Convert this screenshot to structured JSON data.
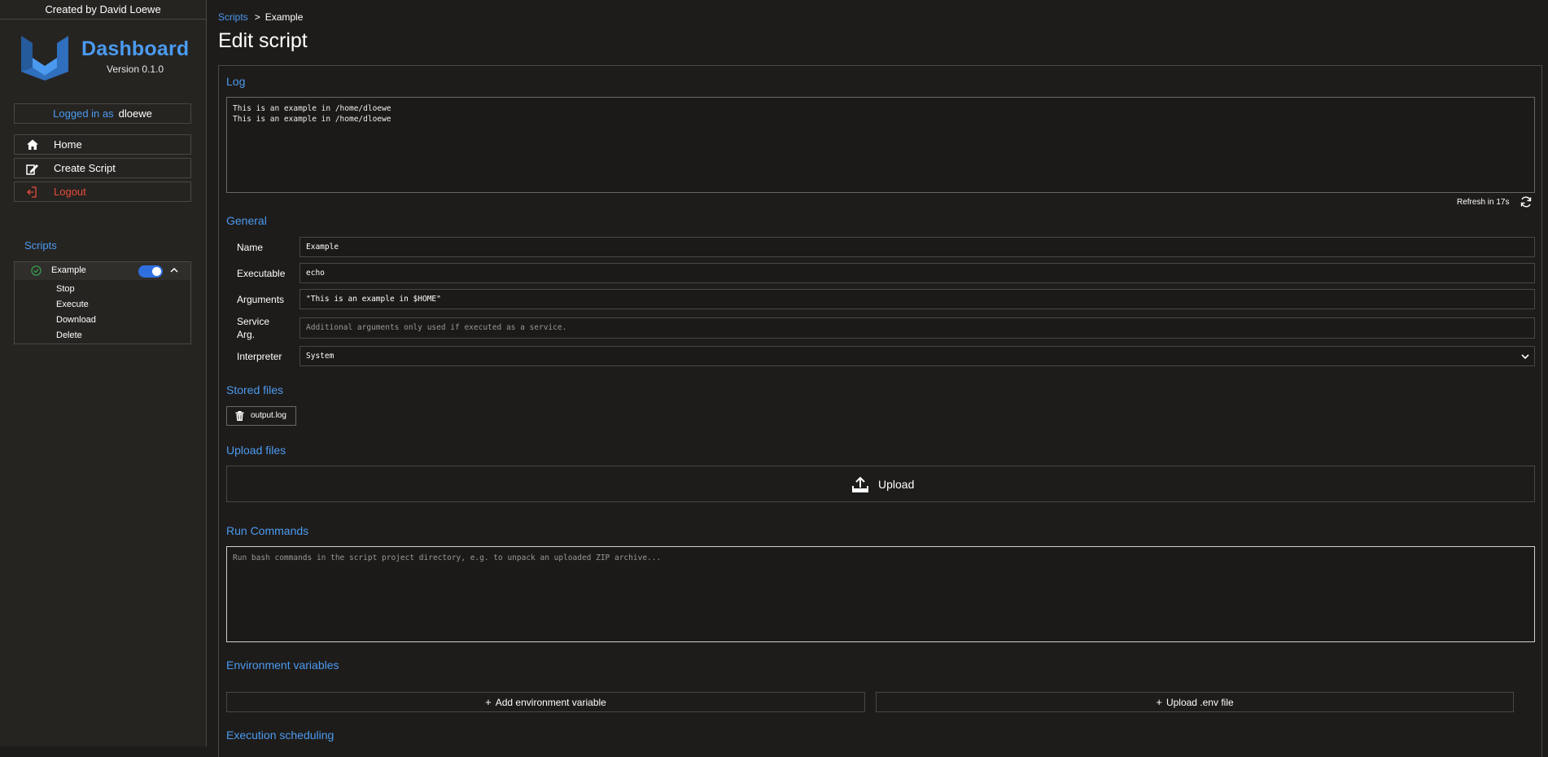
{
  "sidebar": {
    "credit": "Created by David Loewe",
    "brand_title": "Dashboard",
    "brand_version": "Version 0.1.0",
    "login_label": "Logged in as",
    "username": "dloewe",
    "nav": {
      "home": "Home",
      "create_script": "Create Script",
      "logout": "Logout"
    },
    "scripts_heading": "Scripts",
    "script": {
      "name": "Example",
      "enabled": true,
      "actions": {
        "stop": "Stop",
        "execute": "Execute",
        "download": "Download",
        "delete": "Delete"
      }
    }
  },
  "breadcrumb": {
    "parent": "Scripts",
    "separator": ">",
    "current": "Example"
  },
  "page_title": "Edit script",
  "log": {
    "heading": "Log",
    "content": "This is an example in /home/dloewe\nThis is an example in /home/dloewe",
    "refresh_text": "Refresh in 17s"
  },
  "general": {
    "heading": "General",
    "name_label": "Name",
    "name_value": "Example",
    "executable_label": "Executable",
    "executable_value": "echo",
    "arguments_label": "Arguments",
    "arguments_value": "\"This is an example in $HOME\"",
    "service_arg_label_1": "Service",
    "service_arg_label_2": "Arg.",
    "service_arg_placeholder": "Additional arguments only used if executed as a service.",
    "interpreter_label": "Interpreter",
    "interpreter_value": "System"
  },
  "stored_files": {
    "heading": "Stored files",
    "files": [
      "output.log"
    ]
  },
  "upload_files": {
    "heading": "Upload files",
    "button_label": "Upload"
  },
  "run_commands": {
    "heading": "Run Commands",
    "placeholder": "Run bash commands in the script project directory, e.g. to unpack an uploaded ZIP archive..."
  },
  "env": {
    "heading": "Environment variables",
    "add_label": "Add environment variable",
    "upload_label": "Upload .env file"
  },
  "scheduling": {
    "heading": "Execution scheduling"
  },
  "colors": {
    "accent": "#4b9af0",
    "background": "#1e1c1a",
    "danger": "#e74c3c",
    "toggle_on": "#2f6fe0"
  }
}
